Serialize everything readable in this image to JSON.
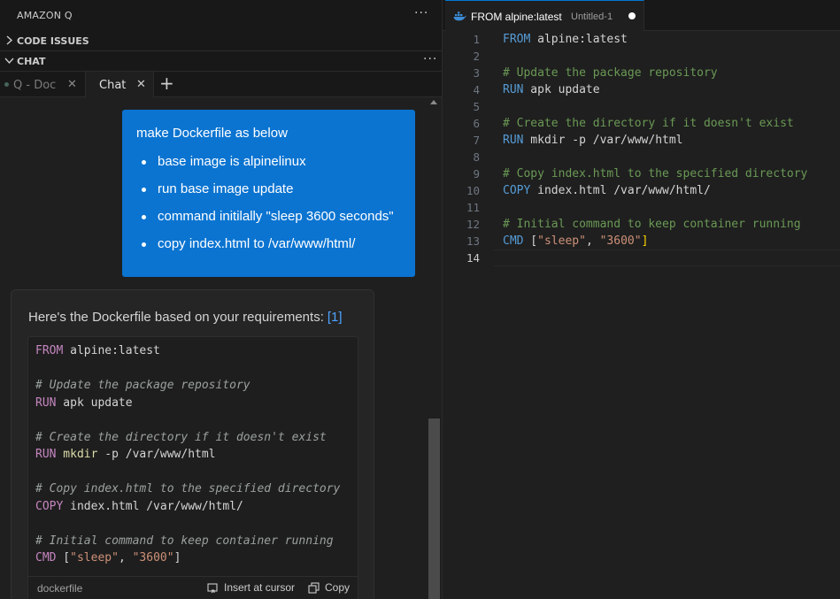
{
  "sidebar": {
    "title": "AMAZON Q",
    "sections": [
      {
        "label": "CODE ISSUES",
        "expanded": false
      },
      {
        "label": "CHAT",
        "expanded": true
      }
    ]
  },
  "chat_tabs": [
    {
      "label": "Q - Doc",
      "active": false
    },
    {
      "label": "Chat",
      "active": true
    }
  ],
  "chat": {
    "user_message": "make Dockerfile as below",
    "user_items": [
      "base image is alpinelinux",
      "run base image update",
      "command initilally \"sleep 3600 seconds\"",
      "copy index.html to /var/www/html/"
    ],
    "answer_text": "Here's the Dockerfile based on your requirements:",
    "answer_ref": "[1]",
    "code_language": "dockerfile",
    "insert_label": "Insert at cursor",
    "copy_label": "Copy",
    "code": {
      "l1_kw": "FROM",
      "l1_rest": " alpine:latest",
      "l3": "# Update the package repository",
      "l4_kw": "RUN",
      "l4_rest": " apk update",
      "l6": "# Create the directory if it doesn't exist",
      "l7_kw": "RUN",
      "l7_fn": " mkdir",
      "l7_rest": " -p /var/www/html",
      "l9": "# Copy index.html to the specified directory",
      "l10_kw": "COPY",
      "l10_rest": " index.html /var/www/html/",
      "l12": "# Initial command to keep container running",
      "l13_kw": "CMD",
      "l13_open": " [",
      "l13_s1": "\"sleep\"",
      "l13_sep": ", ",
      "l13_s2": "\"3600\"",
      "l13_close": "]"
    }
  },
  "editor": {
    "tab_title": "FROM alpine:latest",
    "tab_file": "Untitled-1",
    "line_numbers": [
      "1",
      "2",
      "3",
      "4",
      "5",
      "6",
      "7",
      "8",
      "9",
      "10",
      "11",
      "12",
      "13",
      "14"
    ],
    "active_line": "14",
    "code": {
      "l1_kw": "FROM",
      "l1_rest": " alpine:latest",
      "l3": "# Update the package repository",
      "l4_kw": "RUN",
      "l4_rest": " apk update",
      "l6": "# Create the directory if it doesn't exist",
      "l7_kw": "RUN",
      "l7_rest": " mkdir -p /var/www/html",
      "l9": "# Copy index.html to the specified directory",
      "l10_kw": "COPY",
      "l10_rest": " index.html /var/www/html/",
      "l12": "# Initial command to keep container running",
      "l13_kw": "CMD",
      "l13_open": " [",
      "l13_s1": "\"sleep\"",
      "l13_sep": ", ",
      "l13_s2": "\"3600\"",
      "l13_close": "]"
    }
  },
  "colors": {
    "accent": "#0078d4",
    "user_bubble": "#0b74d1",
    "keyword": "#569cd6",
    "comment": "#6a9955",
    "string": "#ce9178"
  },
  "icons": [
    "ellipsis-icon",
    "chevron-right-icon",
    "chevron-down-icon",
    "close-icon",
    "plus-icon",
    "insert-icon",
    "copy-icon",
    "docker-icon"
  ]
}
